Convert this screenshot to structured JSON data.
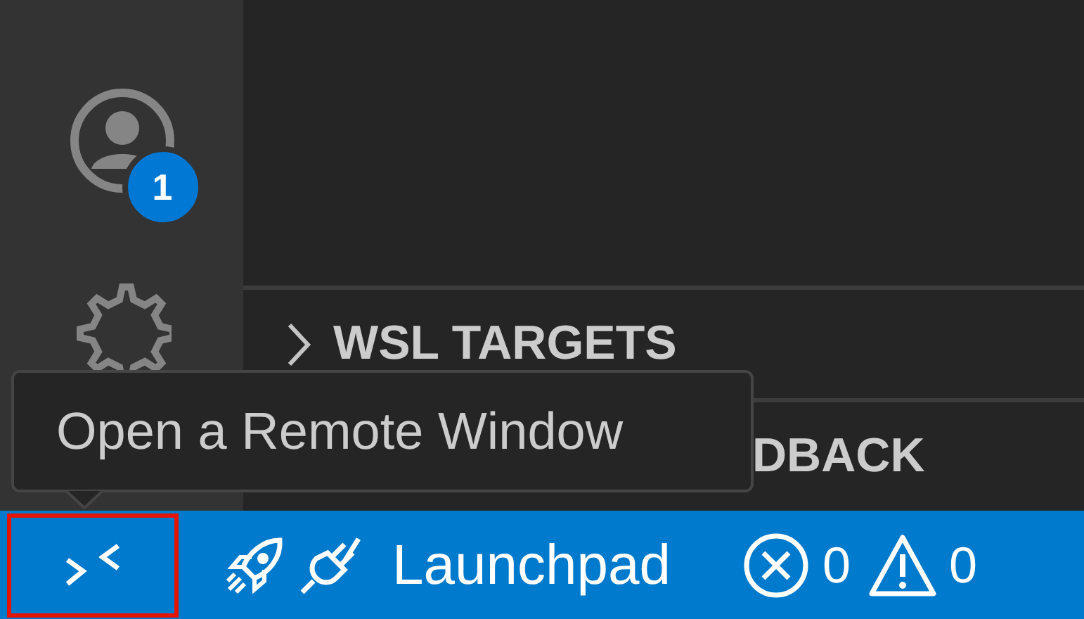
{
  "activity_bar": {
    "account_badge": "1"
  },
  "side_panel": {
    "sections": [
      {
        "title": "WSL TARGETS",
        "expanded": false
      },
      {
        "title": "DBACK"
      }
    ]
  },
  "tooltip": {
    "text": "Open a Remote Window"
  },
  "status_bar": {
    "remote_selected": true,
    "launchpad": "Launchpad",
    "errors": "0",
    "warnings": "0"
  }
}
